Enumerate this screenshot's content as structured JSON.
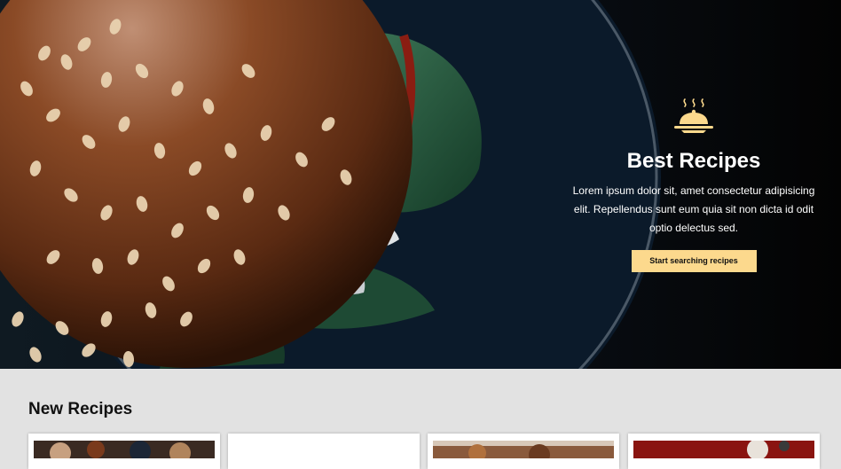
{
  "hero": {
    "title": "Best Recipes",
    "description": "Lorem ipsum dolor sit, amet consectetur adipisicing elit. Repellendus sunt eum quia sit non dicta id odit optio delectus sed.",
    "button_label": "Start searching recipes",
    "icon": "cloche-icon",
    "accent_color": "#fcd98d"
  },
  "new_recipes": {
    "title": "New Recipes",
    "cards": [
      {
        "image": "recipe-photo"
      },
      {
        "image": "recipe-photo"
      },
      {
        "image": "recipe-photo"
      },
      {
        "image": "recipe-photo"
      }
    ]
  }
}
